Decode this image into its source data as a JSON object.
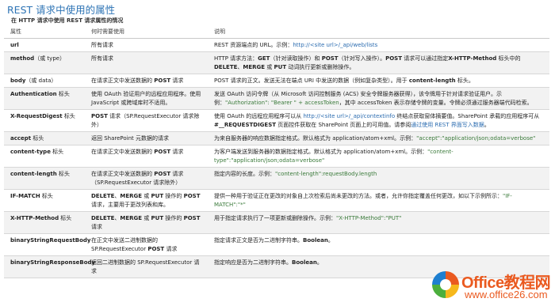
{
  "page": {
    "title": "REST 请求中使用的属性",
    "subtitle": "在 HTTP 请求中使用 REST 请求属性的情况"
  },
  "table": {
    "headers": [
      "属性",
      "何时需要使用",
      "说明"
    ],
    "rows": [
      {
        "name": "url",
        "qual": "",
        "when": [
          {
            "t": "所有请求"
          }
        ],
        "desc": [
          {
            "t": "REST 资源端点的 URL。示例："
          },
          {
            "t": "http://<site url>/_api/web/lists",
            "c": "lnk"
          }
        ]
      },
      {
        "name": "method",
        "qual": "（或 type）",
        "when": [
          {
            "t": "所有请求"
          }
        ],
        "desc": [
          {
            "t": "HTTP 请求方法："
          },
          {
            "t": "GET",
            "c": "b"
          },
          {
            "t": "（针对读取操作）和 "
          },
          {
            "t": "POST",
            "c": "b"
          },
          {
            "t": "（针对写入操作）。"
          },
          {
            "t": "POST",
            "c": "b"
          },
          {
            "t": " 请求可以通过指定"
          },
          {
            "t": "X-HTTP-Method",
            "c": "b"
          },
          {
            "t": " 标头中的 "
          },
          {
            "t": "DELETE",
            "c": "b"
          },
          {
            "t": "、"
          },
          {
            "t": "MERGE",
            "c": "b"
          },
          {
            "t": " 或 "
          },
          {
            "t": "PUT",
            "c": "b"
          },
          {
            "t": " 动词执行更新或删除操作。"
          }
        ]
      },
      {
        "name": "body",
        "qual": "（或 data）",
        "when": [
          {
            "t": "在请求正文中发送数据的 "
          },
          {
            "t": "POST",
            "c": "b"
          },
          {
            "t": " 请求"
          }
        ],
        "desc": [
          {
            "t": "POST 请求的正文。发送无法在端点 URI 中发送的数据（例如复杂类型）。用于 "
          },
          {
            "t": "content-length",
            "c": "b"
          },
          {
            "t": " 标头。"
          }
        ]
      },
      {
        "name": "Authentication",
        "qual": " 标头",
        "when": [
          {
            "t": "使用 OAuth 验证用户的远程应用程序。使用 JavaScript 或跨域库时不适用。"
          }
        ],
        "desc": [
          {
            "t": "发送 OAuth 访问令牌（从 Microsoft 访问控制服务 (ACS) 安全令牌服务器获得），该令牌用于针对请求验证用户。示例："
          },
          {
            "t": "\"Authorization\": \"Bearer \" + accessToken",
            "c": "str"
          },
          {
            "t": "，其中 accessToken 表示存储令牌的变量。令牌必须通过服务器端代码检索。"
          }
        ]
      },
      {
        "name": "X-RequestDigest",
        "qual": " 标头",
        "when": [
          {
            "t": "POST",
            "c": "b"
          },
          {
            "t": " 请求（SP.RequestExecutor 请求除外）"
          }
        ],
        "desc": [
          {
            "t": "使用 OAuth 的远程应用程序可以从 "
          },
          {
            "t": "http://<site url>/_api/contextinfo",
            "c": "lnk"
          },
          {
            "t": " 终结点获取窗体摘要值。SharePoint 承载的应用程序可从 "
          },
          {
            "t": "#__REQUESTDIGEST",
            "c": "b"
          },
          {
            "t": " 页面控件获取在 SharePoint 页面上的可用值。请参阅"
          },
          {
            "t": "通过使用 REST 界面写入数据",
            "c": "lnk"
          },
          {
            "t": "。"
          }
        ]
      },
      {
        "name": "accept",
        "qual": " 标头",
        "when": [
          {
            "t": "返回 SharePoint 元数据的请求"
          }
        ],
        "desc": [
          {
            "t": "为来自服务器的响应数据指定格式。默认格式为 application/atom+xml。示例："
          },
          {
            "t": "\"accept\":\"application/json;odata=verbose\"",
            "c": "str"
          }
        ]
      },
      {
        "name": "content-type",
        "qual": " 标头",
        "when": [
          {
            "t": "在请求正文中发送数据的 "
          },
          {
            "t": "POST",
            "c": "b"
          },
          {
            "t": " 请求"
          }
        ],
        "desc": [
          {
            "t": "为客户端发送到服务器的数据指定格式。默认格式为 application/atom+xml。示例："
          },
          {
            "t": "\"content-type\":\"application/json;odata=verbose\"",
            "c": "str"
          }
        ]
      },
      {
        "name": "content-length",
        "qual": " 标头",
        "when": [
          {
            "t": "在请求正文中发送数据的 "
          },
          {
            "t": "POST",
            "c": "b"
          },
          {
            "t": " 请求（SP.RequestExecutor 请求除外）"
          }
        ],
        "desc": [
          {
            "t": "指定内容的长度。示例："
          },
          {
            "t": "\"content-length\":requestBody.length",
            "c": "str"
          }
        ]
      },
      {
        "name": "IF-MATCH",
        "qual": " 标头",
        "when": [
          {
            "t": "DELETE",
            "c": "b"
          },
          {
            "t": "、"
          },
          {
            "t": "MERGE",
            "c": "b"
          },
          {
            "t": " 或 "
          },
          {
            "t": "PUT",
            "c": "b"
          },
          {
            "t": " 操作的 "
          },
          {
            "t": "POST",
            "c": "b"
          },
          {
            "t": " 请求，主要用于更改列表和库。"
          }
        ],
        "desc": [
          {
            "t": "提供一种用于验证正在更改的对象自上次检索后尚未更改的方法。或者，允许你指定覆盖任何更改，如以下示例所示："
          },
          {
            "t": "\"IF-MATCH\":\"*\"",
            "c": "str"
          }
        ]
      },
      {
        "name": "X-HTTP-Method",
        "qual": " 标头",
        "when": [
          {
            "t": "DELETE",
            "c": "b"
          },
          {
            "t": "、"
          },
          {
            "t": "MERGE",
            "c": "b"
          },
          {
            "t": " 或 "
          },
          {
            "t": "PUT",
            "c": "b"
          },
          {
            "t": " 操作的 "
          },
          {
            "t": "POST",
            "c": "b"
          },
          {
            "t": " 请求"
          }
        ],
        "desc": [
          {
            "t": "用于指定请求执行了一项更新或删除操作。示例："
          },
          {
            "t": "\"X-HTTP-Method\":\"PUT\"",
            "c": "str"
          }
        ]
      },
      {
        "name": "binaryStringRequestBody",
        "qual": "",
        "when": [
          {
            "t": "在正文中发送二进制数据的 SP.RequestExecutor "
          },
          {
            "t": "POST",
            "c": "b"
          },
          {
            "t": " 请求"
          }
        ],
        "desc": [
          {
            "t": "指定请求正文是否为二进制字符串。"
          },
          {
            "t": "Boolean",
            "c": "b"
          },
          {
            "t": "。"
          }
        ]
      },
      {
        "name": "binaryStringResponseBody",
        "qual": "",
        "when": [
          {
            "t": "返回二进制数据的 SP.RequestExecutor 请求"
          }
        ],
        "desc": [
          {
            "t": "指定响应是否为二进制字符串。"
          },
          {
            "t": "Boolean",
            "c": "b"
          },
          {
            "t": "。"
          }
        ]
      }
    ]
  },
  "watermark": {
    "brand": "Office教程网",
    "url": "www.office26.com",
    "colors": {
      "orange": "#ea5a20",
      "blue": "#1e7fd0",
      "green": "#4caf3d",
      "yellow": "#f6b81c"
    }
  },
  "colors": {
    "title": "#2e74b5",
    "link": "#2b6cb0",
    "code": "#3a7a3a",
    "row_alt": "#f2f2f2"
  }
}
